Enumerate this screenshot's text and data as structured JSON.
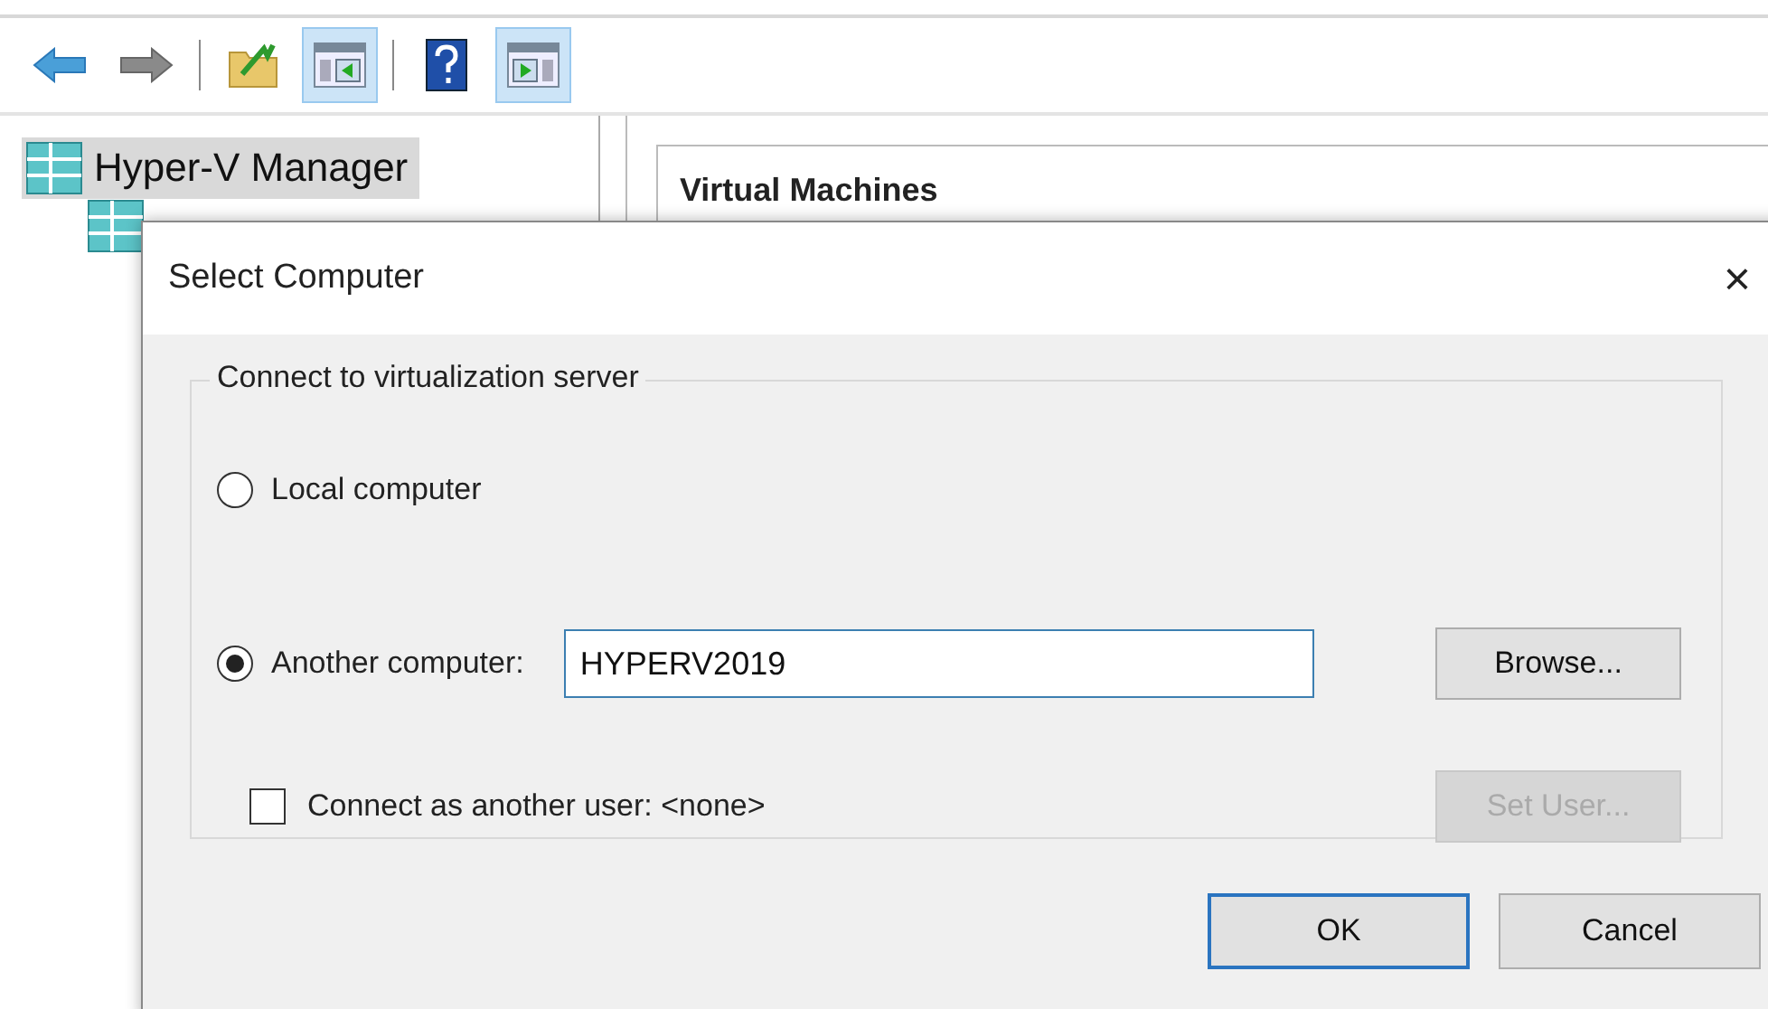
{
  "toolbar": [
    {
      "kind": "back"
    },
    {
      "kind": "forward"
    },
    {
      "kind": "separator"
    },
    {
      "kind": "folder-up"
    },
    {
      "kind": "show-tree",
      "pressed": true
    },
    {
      "kind": "separator"
    },
    {
      "kind": "help"
    },
    {
      "kind": "show-action",
      "pressed": true
    }
  ],
  "tree": {
    "items": [
      {
        "label": "Hyper-V Manager",
        "selected": true,
        "children": [
          {
            "kind": "server"
          }
        ]
      }
    ]
  },
  "main_pane": {
    "heading": "Virtual Machines"
  },
  "dialog": {
    "title": "Select Computer",
    "close": "×",
    "group": {
      "title": "Connect to virtualization server",
      "options": [
        {
          "label": "Local computer",
          "selected": false
        },
        {
          "label": "Another computer:",
          "selected": true,
          "value": "HYPERV2019",
          "button": "Browse..."
        }
      ],
      "checkbox": {
        "label": "Connect as another user: <none>",
        "checked": false
      },
      "set_user": {
        "label": "Set User...",
        "disabled": true
      }
    },
    "buttons": [
      {
        "label": "OK",
        "default": true
      },
      {
        "label": "Cancel",
        "default": false
      }
    ]
  }
}
